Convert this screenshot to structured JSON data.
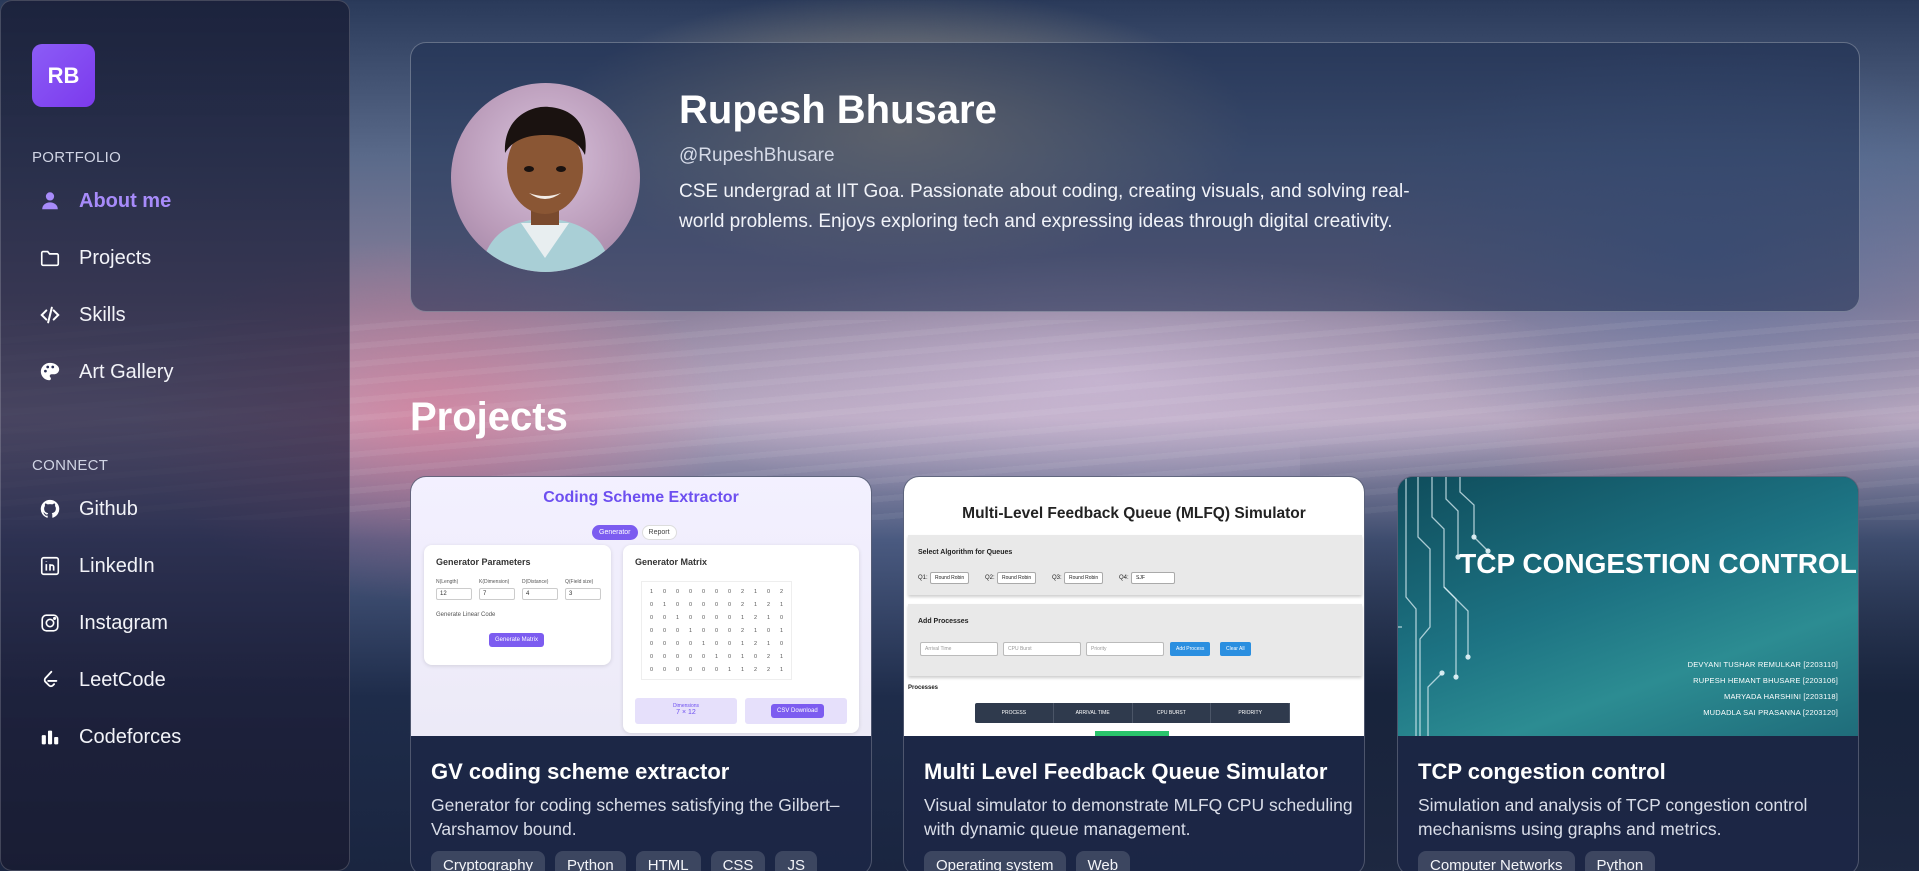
{
  "sidebar": {
    "logo": "RB",
    "portfolio_label": "PORTFOLIO",
    "connect_label": "CONNECT",
    "nav": [
      {
        "label": "About me",
        "icon": "user-icon"
      },
      {
        "label": "Projects",
        "icon": "folder-icon"
      },
      {
        "label": "Skills",
        "icon": "code-icon"
      },
      {
        "label": "Art Gallery",
        "icon": "palette-icon"
      }
    ],
    "connect": [
      {
        "label": "Github",
        "icon": "github-icon"
      },
      {
        "label": "LinkedIn",
        "icon": "linkedin-icon"
      },
      {
        "label": "Instagram",
        "icon": "instagram-icon"
      },
      {
        "label": "LeetCode",
        "icon": "leetcode-icon"
      },
      {
        "label": "Codeforces",
        "icon": "codeforces-icon"
      }
    ]
  },
  "profile": {
    "name": "Rupesh Bhusare",
    "handle": "@RupeshBhusare",
    "bio": "CSE undergrad at IIT Goa. Passionate about coding, creating visuals, and solving real-world problems. Enjoys exploring tech and expressing ideas through digital creativity."
  },
  "projects_title": "Projects",
  "projects": [
    {
      "title": "GV coding scheme extractor",
      "description": "Generator for coding schemes satisfying the Gilbert–Varshamov bound.",
      "tags": [
        "Cryptography",
        "Python",
        "HTML",
        "CSS",
        "JS"
      ],
      "thumb": {
        "heading": "Coding Scheme Extractor",
        "tab_generator": "Generator",
        "tab_report": "Report",
        "params_title": "Generator Parameters",
        "param_labels": [
          "N(Length)",
          "K(Dimension)",
          "D(Distance)",
          "Q(Field size)"
        ],
        "param_values": [
          "12",
          "7",
          "4",
          "3"
        ],
        "checkbox_label": "Generate Linear Code",
        "generate_button": "Generate Matrix",
        "matrix_title": "Generator Matrix",
        "dimensions_label": "Dimensions",
        "dimensions_value": "7 × 12",
        "csv_button": "CSV Download",
        "matrix_rows": [
          [
            "1",
            "0",
            "0",
            "0",
            "0",
            "0",
            "0",
            "2",
            "1",
            "0",
            "2"
          ],
          [
            "0",
            "1",
            "0",
            "0",
            "0",
            "0",
            "0",
            "2",
            "1",
            "2",
            "1"
          ],
          [
            "0",
            "0",
            "1",
            "0",
            "0",
            "0",
            "0",
            "1",
            "2",
            "1",
            "0"
          ],
          [
            "0",
            "0",
            "0",
            "1",
            "0",
            "0",
            "0",
            "2",
            "1",
            "0",
            "1"
          ],
          [
            "0",
            "0",
            "0",
            "0",
            "1",
            "0",
            "0",
            "1",
            "2",
            "1",
            "0"
          ],
          [
            "0",
            "0",
            "0",
            "0",
            "0",
            "1",
            "0",
            "1",
            "0",
            "2",
            "1"
          ],
          [
            "0",
            "0",
            "0",
            "0",
            "0",
            "0",
            "1",
            "1",
            "2",
            "2",
            "1"
          ]
        ]
      }
    },
    {
      "title": "Multi Level Feedback Queue Simulator",
      "description": "Visual simulator to demonstrate MLFQ CPU scheduling with dynamic queue management.",
      "tags": [
        "Operating system",
        "Web"
      ],
      "thumb": {
        "heading": "Multi-Level Feedback Queue (MLFQ) Simulator",
        "select_title": "Select Algorithm for Queues",
        "queues": [
          {
            "label": "Q1:",
            "value": "Round Robin"
          },
          {
            "label": "Q2:",
            "value": "Round Robin"
          },
          {
            "label": "Q3:",
            "value": "Round Robin"
          },
          {
            "label": "Q4:",
            "value": "SJF"
          }
        ],
        "add_title": "Add Processes",
        "placeholders": [
          "Arrival Time",
          "CPU Burst",
          "Priority"
        ],
        "add_button": "Add Process",
        "clear_button": "Clear All",
        "processes_label": "Processes",
        "columns": [
          "PROCESS",
          "ARRIVAL TIME",
          "CPU BURST",
          "PRIORITY"
        ]
      }
    },
    {
      "title": "TCP congestion control",
      "description": "Simulation and analysis of TCP congestion control mechanisms using graphs and metrics.",
      "tags": [
        "Computer Networks",
        "Python"
      ],
      "thumb": {
        "heading": "TCP CONGESTION CONTROL",
        "names": [
          "DEVYANI TUSHAR REMULKAR [2203110]",
          "RUPESH HEMANT BHUSARE [2203106]",
          "MARYADA HARSHINI [2203118]",
          "MUDADLA SAI PRASANNA [2203120]"
        ]
      }
    }
  ],
  "colors": {
    "accent": "#8b5cf6",
    "active_nav": "#a78bfa"
  }
}
